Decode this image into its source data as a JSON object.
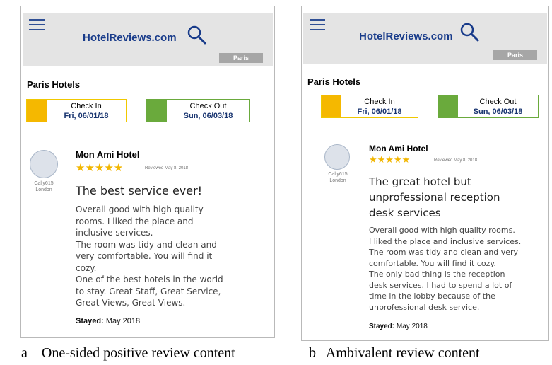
{
  "panels": [
    {
      "header": {
        "brand": "HotelReviews.com",
        "city": "Paris"
      },
      "section_title": "Paris Hotels",
      "check_in": {
        "label": "Check In",
        "date": "Fri, 06/01/18"
      },
      "check_out": {
        "label": "Check Out",
        "date": "Sun, 06/03/18"
      },
      "review": {
        "reviewer_name": "Cally615",
        "reviewer_city": "London",
        "hotel": "Mon Ami Hotel",
        "stars": "★★★★★",
        "rating": 5,
        "reviewed_date": "Reviewed May 8, 2018",
        "title": "The best service ever!",
        "body": [
          "Overall good with high quality",
          "rooms. I liked the place and",
          "inclusive services.",
          "The room was tidy and clean and",
          "very comfortable. You will find it",
          "cozy.",
          "One of the best hotels in the world",
          "to stay. Great Staff, Great Service,",
          "Great Views, Great Views."
        ],
        "stayed_label": "Stayed:",
        "stayed_value": "May 2018"
      },
      "caption": {
        "letter": "a",
        "text": "One-sided positive review content"
      }
    },
    {
      "header": {
        "brand": "HotelReviews.com",
        "city": "Paris"
      },
      "section_title": "Paris Hotels",
      "check_in": {
        "label": "Check In",
        "date": "Fri, 06/01/18"
      },
      "check_out": {
        "label": "Check Out",
        "date": "Sun, 06/03/18"
      },
      "review": {
        "reviewer_name": "Cally615",
        "reviewer_city": "London",
        "hotel": "Mon Ami Hotel",
        "stars": "★★★★★",
        "rating": 5,
        "reviewed_date": "Reviewed May 8, 2018",
        "title": [
          "The great hotel but",
          "unprofessional reception",
          "desk services"
        ],
        "body": [
          "Overall good with high quality rooms.",
          "I liked the place and inclusive services.",
          "The room was tidy and clean and very",
          "comfortable. You will find it cozy.",
          "The only bad thing is the reception",
          "desk services. I had to spend a lot of",
          "time in the lobby because of the",
          "unprofessional desk service."
        ],
        "stayed_label": "Stayed:",
        "stayed_value": "May 2018"
      },
      "caption": {
        "letter": "b",
        "text": "Ambivalent review content"
      }
    }
  ],
  "colors": {
    "brand": "#183b8a",
    "check_in_accent": "#f5b800",
    "check_out_accent": "#6aaa3c",
    "stars": "#f2b600"
  }
}
